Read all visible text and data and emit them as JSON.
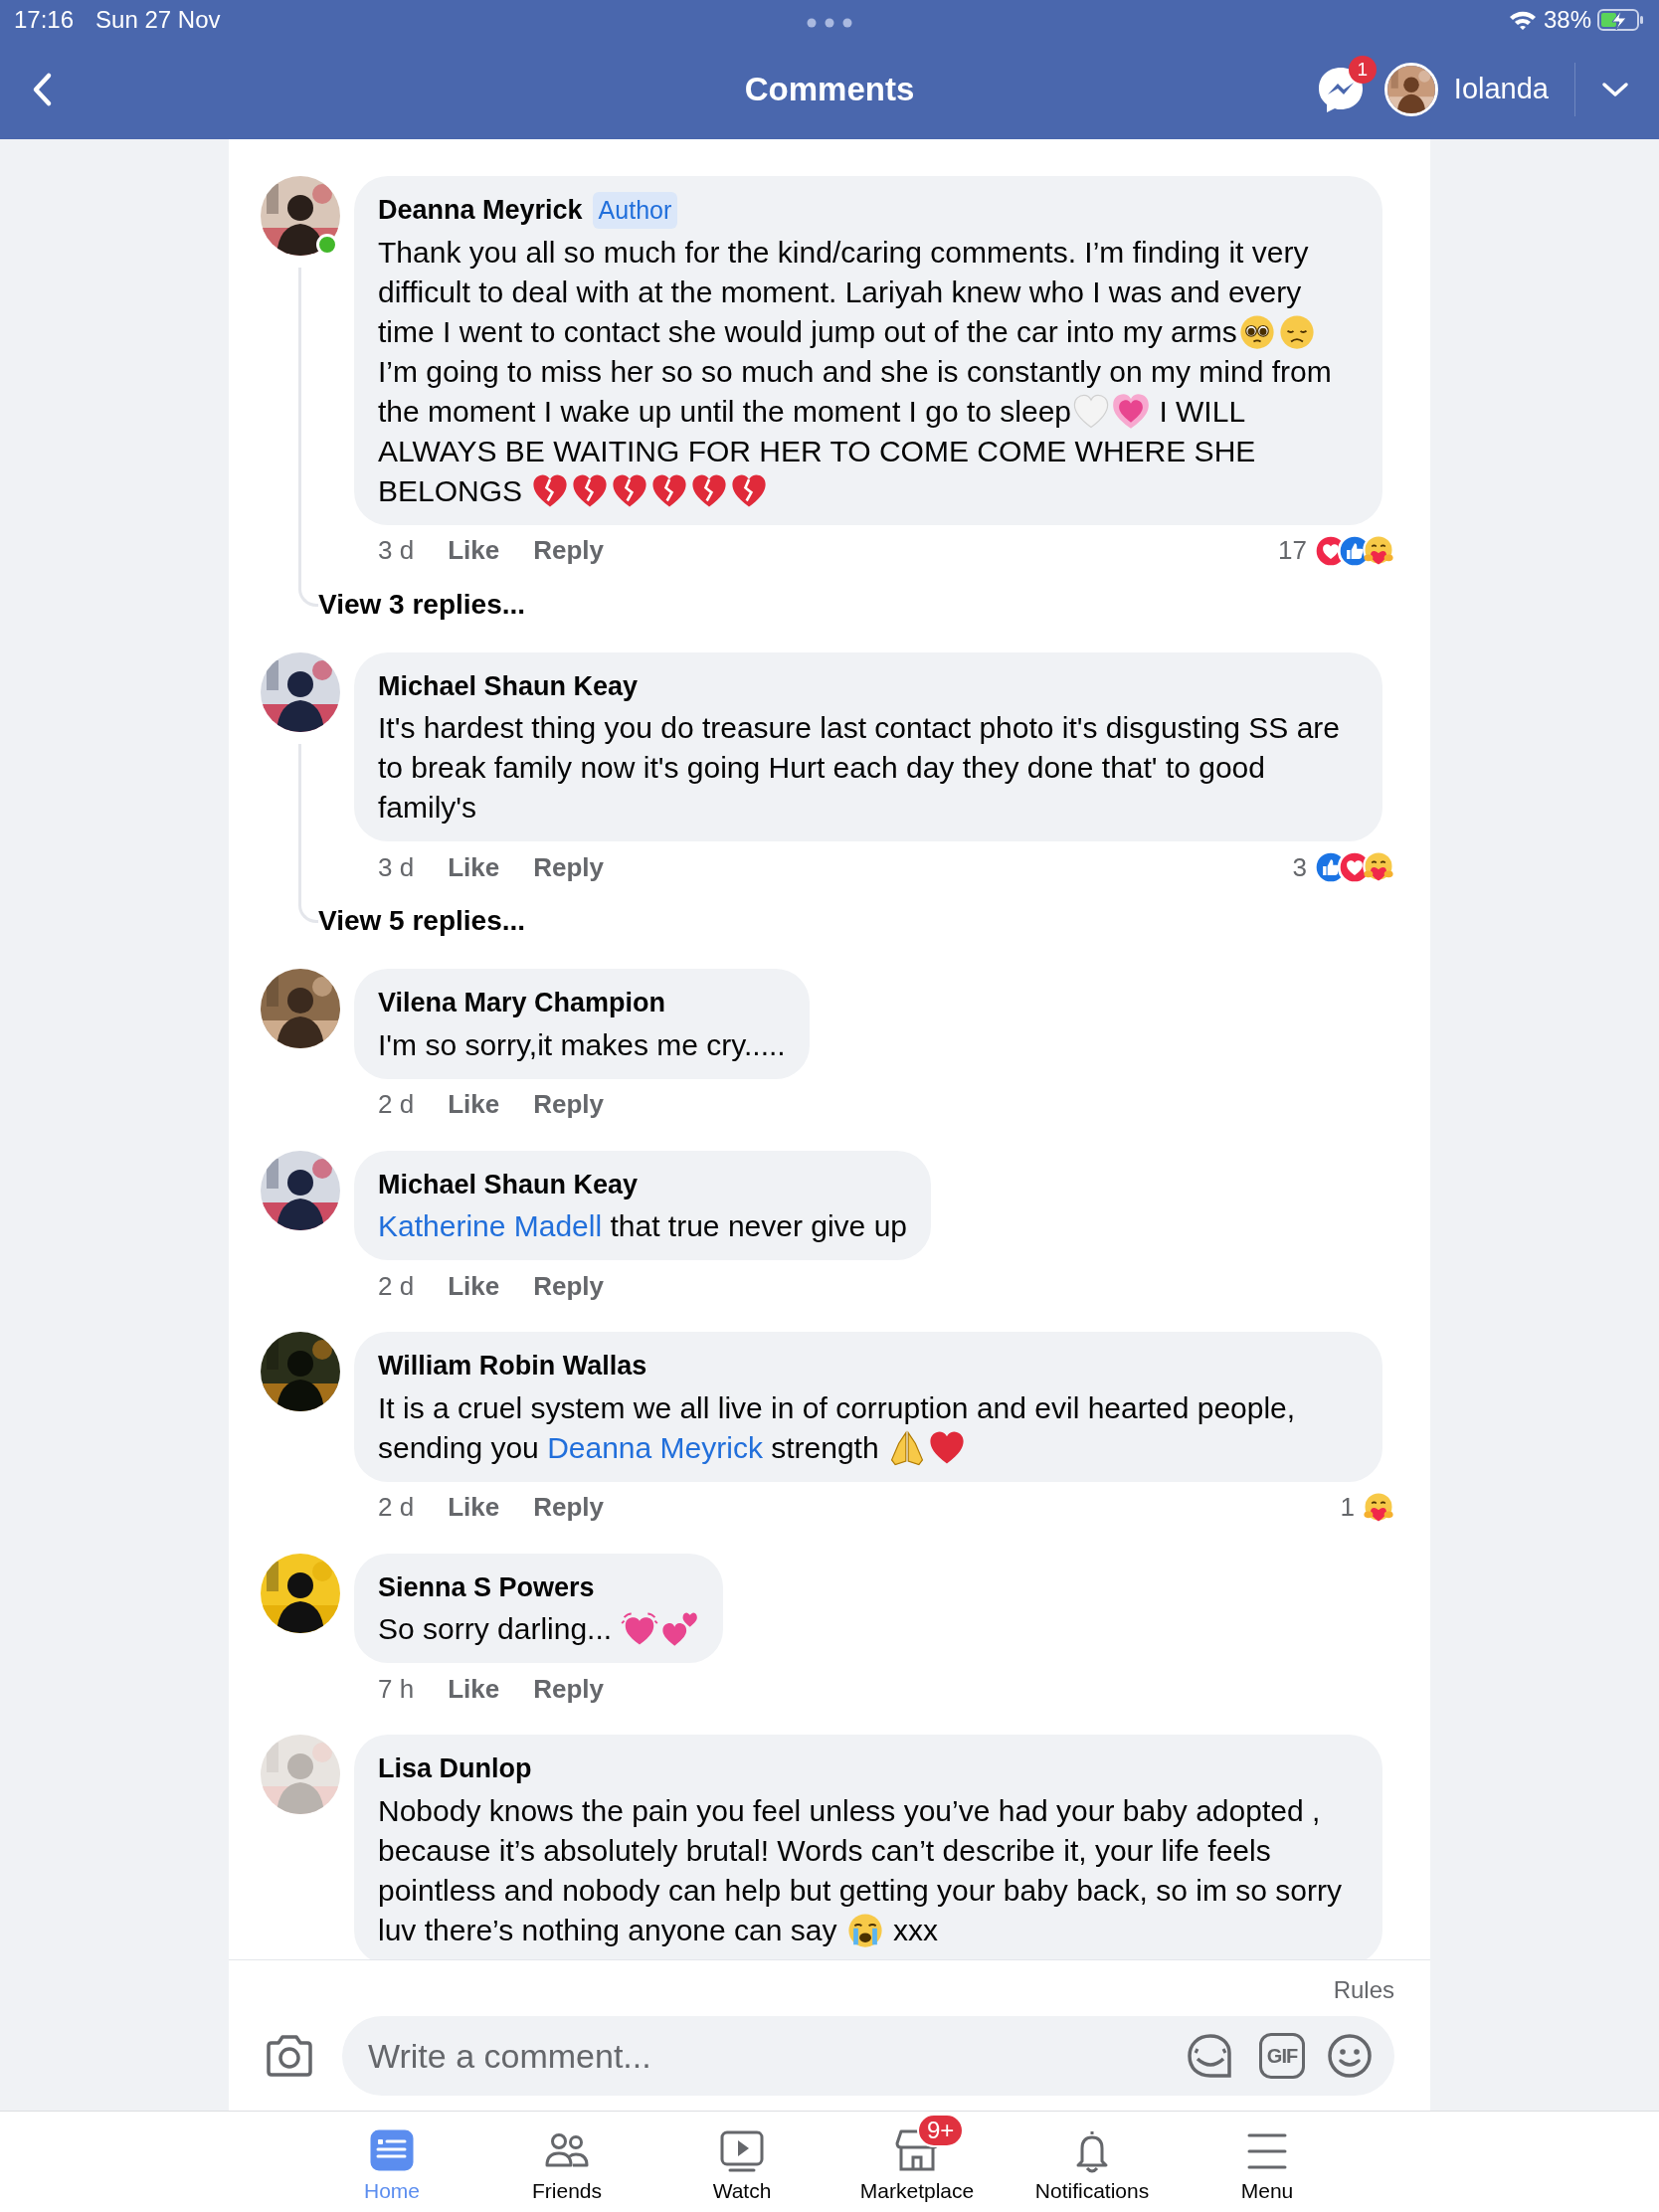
{
  "status_bar": {
    "time": "17:16",
    "date": "Sun 27 Nov",
    "battery": "38%"
  },
  "header": {
    "title": "Comments",
    "messenger_badge": "1",
    "user_name": "Iolanda",
    "avatar": {
      "kind": "picture"
    }
  },
  "comments": [
    {
      "author": "Deanna Meyrick",
      "badge": "Author",
      "online": true,
      "avatar": {
        "kind": "picture"
      },
      "parts": [
        {
          "kind": "text",
          "text": "Thank you all so much for the kind/caring comments. I’m finding it very difficult to deal with at the moment. Lariyah knew who I was and every time I went to contact she would jump out of the car into my arms"
        },
        {
          "kind": "pleading-face"
        },
        {
          "kind": "sad-face"
        },
        {
          "kind": "text",
          "text": " I’m going to miss her so so much and she is constantly on my mind from the moment I wake up until the moment I go to sleep"
        },
        {
          "kind": "outline-heart"
        },
        {
          "kind": "growing-heart"
        },
        {
          "kind": "text",
          "text": " I WILL ALWAYS BE WAITING FOR HER TO COME COME WHERE SHE BELONGS "
        },
        {
          "kind": "broken-heart"
        },
        {
          "kind": "broken-heart"
        },
        {
          "kind": "broken-heart"
        },
        {
          "kind": "broken-heart"
        },
        {
          "kind": "broken-heart"
        },
        {
          "kind": "broken-heart"
        }
      ],
      "time": "3 d",
      "like": "Like",
      "reply": "Reply",
      "reaction_count": "17",
      "reactions": [
        {
          "kind": "love"
        },
        {
          "kind": "like"
        },
        {
          "kind": "care"
        }
      ],
      "view_replies": "View 3 replies..."
    },
    {
      "author": "Michael Shaun Keay",
      "online": false,
      "avatar": {
        "kind": "picture"
      },
      "parts": [
        {
          "kind": "text",
          "text": "It's hardest thing you do treasure last contact photo it's disgusting SS are to break family now it's going Hurt each day they done that' to good family's"
        }
      ],
      "time": "3 d",
      "like": "Like",
      "reply": "Reply",
      "reaction_count": "3",
      "reactions": [
        {
          "kind": "like"
        },
        {
          "kind": "love"
        },
        {
          "kind": "care"
        }
      ],
      "view_replies": "View 5 replies..."
    },
    {
      "author": "Vilena Mary Champion",
      "online": false,
      "avatar": {
        "kind": "picture"
      },
      "parts": [
        {
          "kind": "text",
          "text": "I'm so sorry,it makes me cry....."
        }
      ],
      "time": "2 d",
      "like": "Like",
      "reply": "Reply"
    },
    {
      "author": "Michael Shaun Keay",
      "online": false,
      "avatar": {
        "kind": "picture"
      },
      "parts": [
        {
          "kind": "mention",
          "text": "Katherine Madell"
        },
        {
          "kind": "text",
          "text": " that true never give up"
        }
      ],
      "time": "2 d",
      "like": "Like",
      "reply": "Reply"
    },
    {
      "author": "William Robin Wallas",
      "online": false,
      "avatar": {
        "kind": "picture"
      },
      "parts": [
        {
          "kind": "text",
          "text": "It is a cruel system we all live in of corruption and evil hearted people, sending you "
        },
        {
          "kind": "mention",
          "text": "Deanna Meyrick"
        },
        {
          "kind": "text",
          "text": " strength "
        },
        {
          "kind": "praying-hands"
        },
        {
          "kind": "heart"
        }
      ],
      "time": "2 d",
      "like": "Like",
      "reply": "Reply",
      "reaction_count": "1",
      "reactions": [
        {
          "kind": "care"
        }
      ]
    },
    {
      "author": "Sienna S Powers",
      "online": false,
      "avatar": {
        "kind": "picture"
      },
      "parts": [
        {
          "kind": "text",
          "text": "So sorry darling... "
        },
        {
          "kind": "sparkling-heart"
        },
        {
          "kind": "two-hearts"
        }
      ],
      "time": "7 h",
      "like": "Like",
      "reply": "Reply"
    },
    {
      "author": "Lisa Dunlop",
      "online": false,
      "avatar": {
        "kind": "picture"
      },
      "parts": [
        {
          "kind": "text",
          "text": "Nobody knows the pain you feel unless you’ve had your baby adopted , because it’s absolutely brutal! Words can’t describe it, your life feels pointless and nobody can help but getting your baby back, so im so sorry luv there’s nothing anyone can say "
        },
        {
          "kind": "crying-face"
        },
        {
          "kind": "text",
          "text": " xxx"
        }
      ]
    }
  ],
  "composer": {
    "rules": "Rules",
    "placeholder": "Write a comment...",
    "gif": "GIF"
  },
  "tabs": [
    {
      "label": "Home",
      "kind": "home",
      "selected": true
    },
    {
      "label": "Friends",
      "kind": "friends",
      "selected": false
    },
    {
      "label": "Watch",
      "kind": "watch",
      "selected": false
    },
    {
      "label": "Marketplace",
      "kind": "marketplace",
      "selected": false,
      "badge": "9+"
    },
    {
      "label": "Notifications",
      "kind": "notifications",
      "selected": false
    },
    {
      "label": "Menu",
      "kind": "menu",
      "selected": false
    }
  ]
}
